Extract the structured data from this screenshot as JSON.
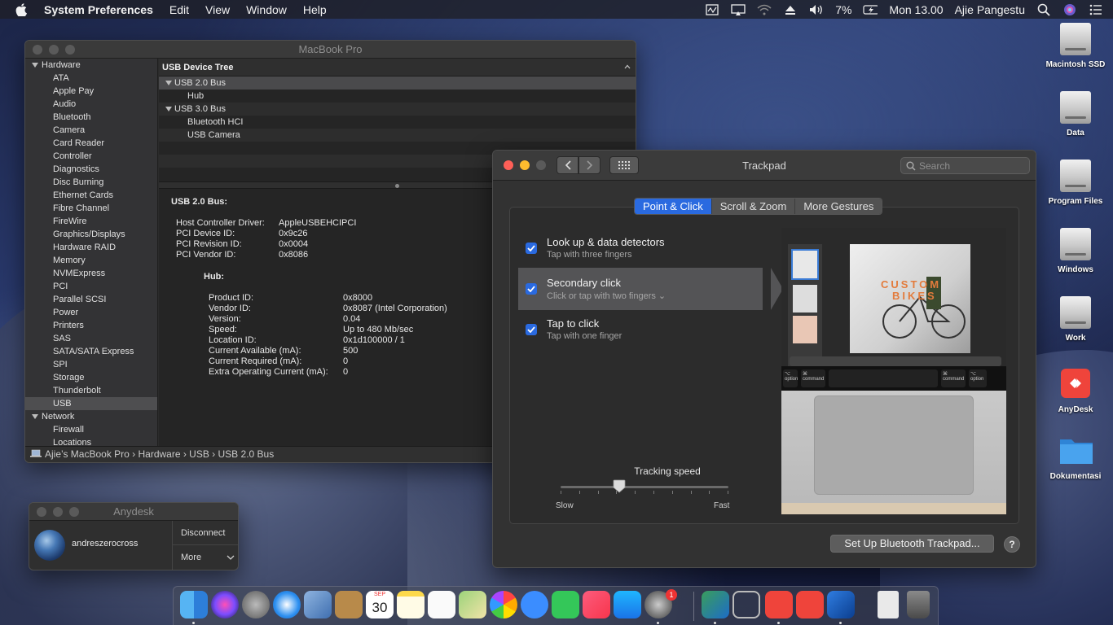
{
  "menubar": {
    "app": "System Preferences",
    "items": [
      "Edit",
      "View",
      "Window",
      "Help"
    ],
    "battery": "7%",
    "clock": "Mon 13.00",
    "user": "Ajie Pangestu"
  },
  "sysinfo": {
    "title": "MacBook Pro",
    "sidebar": {
      "hardware_header": "Hardware",
      "hardware_items": [
        "ATA",
        "Apple Pay",
        "Audio",
        "Bluetooth",
        "Camera",
        "Card Reader",
        "Controller",
        "Diagnostics",
        "Disc Burning",
        "Ethernet Cards",
        "Fibre Channel",
        "FireWire",
        "Graphics/Displays",
        "Hardware RAID",
        "Memory",
        "NVMExpress",
        "PCI",
        "Parallel SCSI",
        "Power",
        "Printers",
        "SAS",
        "SATA/SATA Express",
        "SPI",
        "Storage",
        "Thunderbolt",
        "USB"
      ],
      "network_header": "Network",
      "network_items": [
        "Firewall",
        "Locations"
      ]
    },
    "tree_header": "USB Device Tree",
    "tree": {
      "usb2": "USB 2.0 Bus",
      "hub": "Hub",
      "usb3": "USB 3.0 Bus",
      "bt_hci": "Bluetooth HCI",
      "usb_camera": "USB Camera"
    },
    "detail": {
      "heading": "USB 2.0 Bus:",
      "props": [
        {
          "k": "Host Controller Driver:",
          "v": "AppleUSBEHCIPCI"
        },
        {
          "k": "PCI Device ID:",
          "v": "0x9c26"
        },
        {
          "k": "PCI Revision ID:",
          "v": "0x0004"
        },
        {
          "k": "PCI Vendor ID:",
          "v": "0x8086"
        }
      ],
      "sub_heading": "Hub:",
      "sub_props": [
        {
          "k": "Product ID:",
          "v": "0x8000"
        },
        {
          "k": "Vendor ID:",
          "v": "0x8087  (Intel Corporation)"
        },
        {
          "k": "Version:",
          "v": "0.04"
        },
        {
          "k": "Speed:",
          "v": "Up to 480 Mb/sec"
        },
        {
          "k": "Location ID:",
          "v": "0x1d100000 / 1"
        },
        {
          "k": "Current Available (mA):",
          "v": "500"
        },
        {
          "k": "Current Required (mA):",
          "v": "0"
        },
        {
          "k": "Extra Operating Current (mA):",
          "v": "0"
        }
      ]
    },
    "path": "Ajie’s MacBook Pro › Hardware › USB › USB 2.0 Bus"
  },
  "trackpad": {
    "title": "Trackpad",
    "search_placeholder": "Search",
    "tabs": [
      "Point & Click",
      "Scroll & Zoom",
      "More Gestures"
    ],
    "options": [
      {
        "title": "Look up & data detectors",
        "sub": "Tap with three fingers"
      },
      {
        "title": "Secondary click",
        "sub": "Click or tap with two fingers ⌄"
      },
      {
        "title": "Tap to click",
        "sub": "Tap with one finger"
      }
    ],
    "speed_label": "Tracking speed",
    "slow": "Slow",
    "fast": "Fast",
    "speed_value_fraction": 0.35,
    "preview_text": [
      "CUSTOM",
      "BIKES"
    ],
    "keys": {
      "option": "option",
      "command": "command",
      "cmd_symbol": "⌘",
      "alt_symbol": "⌥"
    },
    "setup_button": "Set Up Bluetooth Trackpad...",
    "help": "?"
  },
  "anydesk": {
    "title": "Anydesk",
    "user": "andreszerocross",
    "disconnect": "Disconnect",
    "more": "More"
  },
  "desktop_icons": [
    "Macintosh SSD",
    "Data",
    "Program Files",
    "Windows",
    "Work",
    "AnyDesk",
    "Dokumentasi"
  ],
  "dock": {
    "calendar_month": "SEP",
    "calendar_day": "30",
    "badge": "1"
  },
  "colors": {
    "accent": "#2a6ae0",
    "close": "#fe5f57",
    "minimize": "#febc2e"
  }
}
